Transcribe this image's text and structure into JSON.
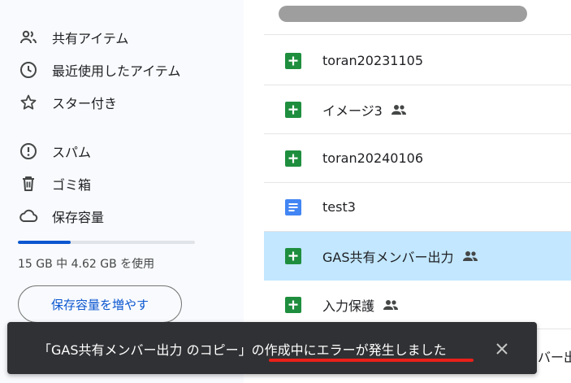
{
  "sidebar": {
    "items": [
      {
        "label": "共有アイテム",
        "icon": "shared-users-icon"
      },
      {
        "label": "最近使用したアイテム",
        "icon": "clock-icon"
      },
      {
        "label": "スター付き",
        "icon": "star-icon"
      },
      {
        "label": "スパム",
        "icon": "spam-icon"
      },
      {
        "label": "ゴミ箱",
        "icon": "trash-icon"
      },
      {
        "label": "保存容量",
        "icon": "cloud-icon"
      }
    ],
    "storage": {
      "used_fraction": 0.3,
      "text": "15 GB 中 4.62 GB を使用",
      "button_label": "保存容量を増やす"
    }
  },
  "files": [
    {
      "name": "toran20231105",
      "type": "sheets",
      "shared": false,
      "selected": false
    },
    {
      "name": "イメージ3",
      "type": "sheets",
      "shared": true,
      "selected": false
    },
    {
      "name": "toran20240106",
      "type": "sheets",
      "shared": false,
      "selected": false
    },
    {
      "name": "test3",
      "type": "docs",
      "shared": false,
      "selected": false
    },
    {
      "name": "GAS共有メンバー出力",
      "type": "sheets",
      "shared": true,
      "selected": true
    },
    {
      "name": "入力保護",
      "type": "sheets",
      "shared": true,
      "selected": false
    }
  ],
  "snackbar": {
    "message": "「GAS共有メンバー出力 のコピー」の作成中にエラーが発生しました",
    "close_icon": "close-icon"
  },
  "peek_text": "バー出",
  "colors": {
    "sheets": "#1e8e3e",
    "docs": "#4285f4",
    "accent": "#0b57d0",
    "selected_row": "#c2e7ff",
    "snackbar": "#303134",
    "underline": "#e8201a"
  }
}
